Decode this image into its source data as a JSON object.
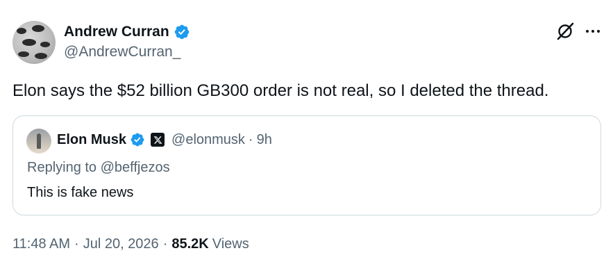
{
  "author": {
    "name": "Andrew Curran",
    "handle": "@AndrewCurran_"
  },
  "tweet": {
    "text": "Elon says the $52 billion GB300 order is not real, so I deleted the thread."
  },
  "quoted": {
    "name": "Elon Musk",
    "handle": "@elonmusk",
    "separator": "·",
    "time": "9h",
    "reply_prefix": "Replying to ",
    "reply_to": "@beffjezos",
    "text": "This is fake news"
  },
  "meta": {
    "time": "11:48 AM",
    "sep1": "·",
    "date": "Jul 20, 2026",
    "sep2": "·",
    "views_count": "85.2K",
    "views_label": "Views"
  },
  "icons": {
    "verified": "verified-badge-icon",
    "grok": "grok-icon",
    "more": "more-horizontal-icon",
    "x_logo": "x-logo-icon"
  },
  "colors": {
    "verified_blue": "#1d9bf0",
    "text_primary": "#0f1419",
    "text_secondary": "#536471",
    "border": "#cfd9de"
  }
}
